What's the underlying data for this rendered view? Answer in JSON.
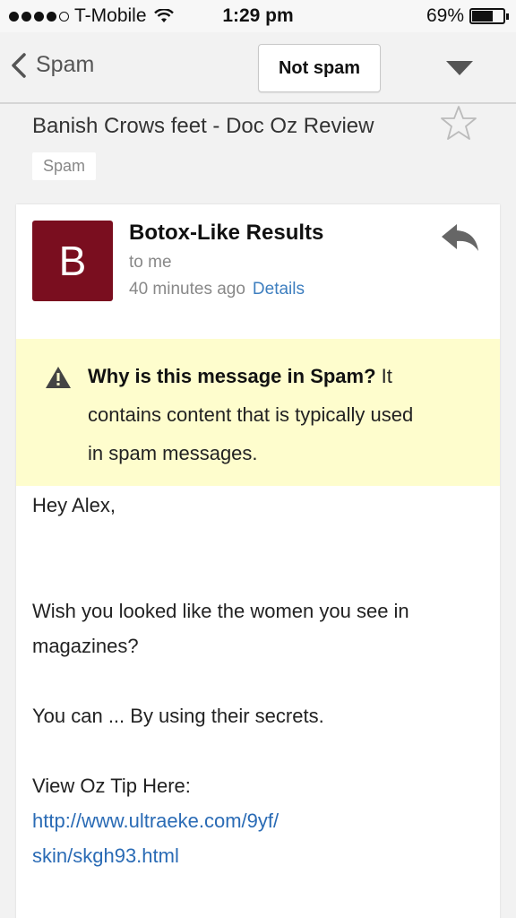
{
  "status_bar": {
    "signal_dots_filled": 4,
    "signal_dots_total": 5,
    "carrier": "T-Mobile",
    "time": "1:29 pm",
    "battery": "69%",
    "battery_level": 0.69
  },
  "nav": {
    "back_label": "Spam",
    "not_spam_label": "Not spam"
  },
  "message": {
    "subject": "Banish Crows feet - Doc Oz Review",
    "label": "Spam",
    "avatar_letter": "B",
    "avatar_color": "#7a0e1f",
    "sender": "Botox-Like Results",
    "to": "to me",
    "time_ago": "40 minutes ago",
    "details_label": "Details"
  },
  "spam_warning": {
    "heading": "Why is this message in Spam?",
    "line1_rest": " It",
    "line2": "contains content that is typically used",
    "line3": "in spam messages."
  },
  "body": {
    "greeting": "Hey Alex,",
    "para1_line1": "Wish you looked like the women you see in",
    "para1_line2": "magazines?",
    "para2": "You can ... By using their secrets.",
    "para3": "View Oz Tip Here:",
    "link_line1": "http://www.ultraeke.com/9yf/",
    "link_line2": "skin/skgh93.html"
  },
  "colors": {
    "accent_link": "#2a6bb5",
    "warning_bg": "#fefdcd"
  }
}
